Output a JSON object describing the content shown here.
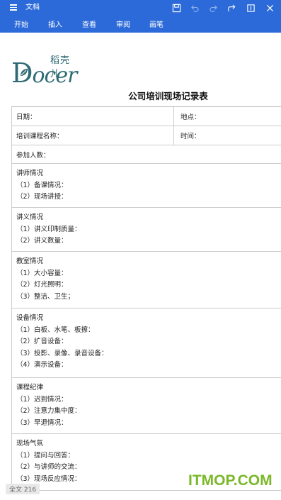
{
  "app": {
    "doc_title": "文档",
    "tabs": [
      "开始",
      "插入",
      "查看",
      "审阅",
      "画笔"
    ],
    "toolbar_icons": [
      "save-icon",
      "undo-icon",
      "redo-icon",
      "share-icon",
      "fullscreen-icon",
      "close-icon"
    ]
  },
  "logo": {
    "zh": "稻壳儿",
    "d": "D",
    "rest": "ocer"
  },
  "form": {
    "title": "公司培训现场记录表",
    "date_label": "日期：",
    "place_label": "地点：",
    "course_label": "培训课程名称：",
    "time_label": "时间：",
    "attendees_label": "参加人数：",
    "sections": [
      {
        "heading": "讲师情况",
        "items": [
          "（1）备课情况：",
          "（2）现场讲授："
        ]
      },
      {
        "heading": "讲义情况",
        "items": [
          "（1）讲义印制质量：",
          "（2）讲义数量："
        ]
      },
      {
        "heading": "教室情况",
        "items": [
          "（1）大小容量：",
          "（2）灯光照明：",
          "（3）整洁、卫生；"
        ]
      },
      {
        "heading": "设备情况",
        "items": [
          "（1）白板、水笔、板擦：",
          "（2）扩音设备：",
          "（3）投影、录像、录音设备：",
          "（4）演示设备："
        ]
      },
      {
        "heading": "课程纪律",
        "items": [
          "（1）迟到情况：",
          "（2）注意力集中度：",
          "（3）早退情况："
        ]
      },
      {
        "heading": "现场气氛",
        "items": [
          "（1）提问与回答：",
          "（2）与讲师的交流：",
          "（3）现场反应情况："
        ]
      }
    ]
  },
  "status": {
    "word_count": "全文 216"
  },
  "watermark": "ITMOP.COM",
  "colors": {
    "toolbar_bg": "#2b6ad8",
    "logo": "#2e6b74",
    "watermark": "#7ab829"
  }
}
